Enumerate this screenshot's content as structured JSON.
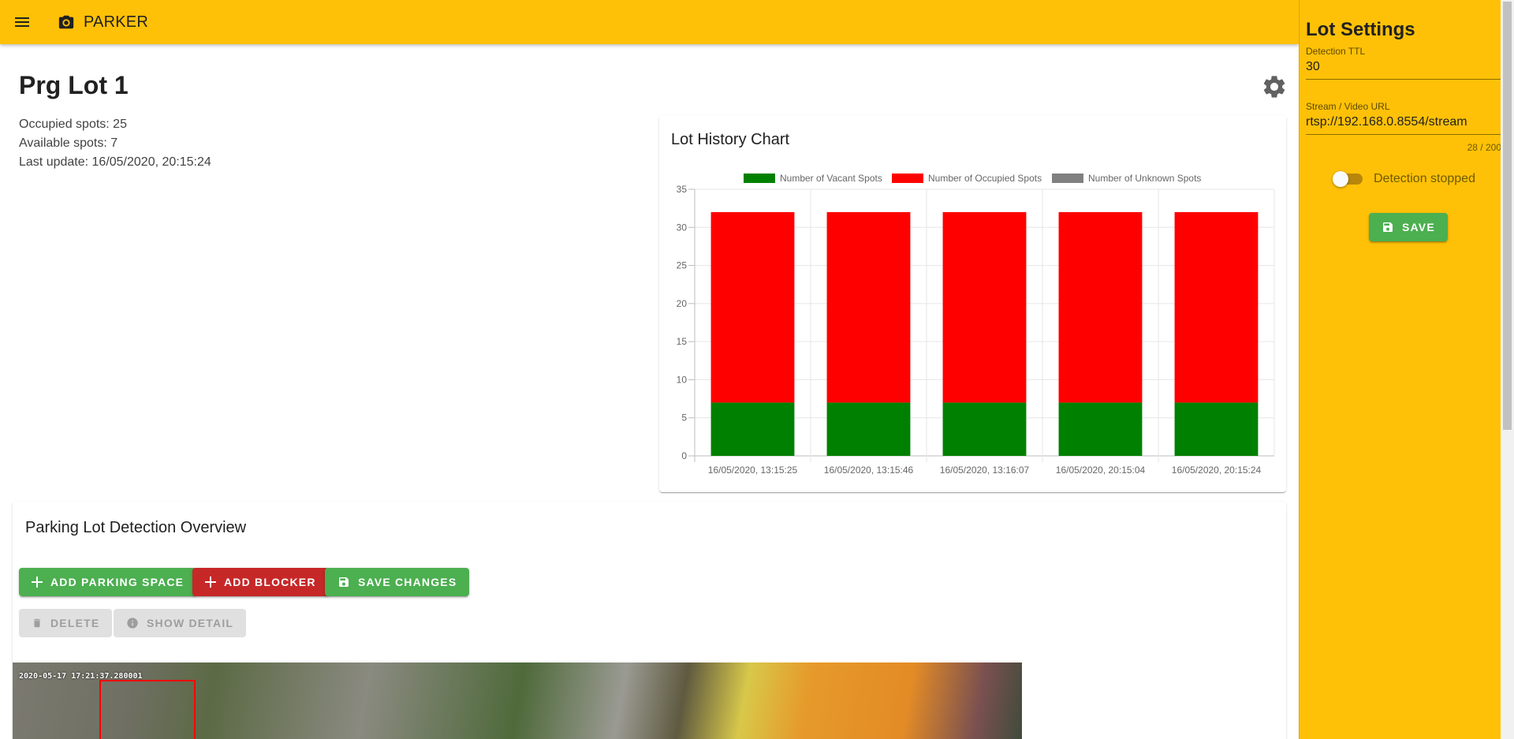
{
  "app": {
    "title": "PARKER"
  },
  "page": {
    "title": "Prg Lot 1",
    "stats": {
      "occupied": "Occupied spots: 25",
      "available": "Available spots: 7",
      "last_update": "Last update: 16/05/2020, 20:15:24"
    }
  },
  "chart_card": {
    "title": "Lot History Chart"
  },
  "chart_data": {
    "type": "bar",
    "stacked": true,
    "categories": [
      "16/05/2020, 13:15:25",
      "16/05/2020, 13:15:46",
      "16/05/2020, 13:16:07",
      "16/05/2020, 20:15:04",
      "16/05/2020, 20:15:24"
    ],
    "series": [
      {
        "name": "Number of Vacant Spots",
        "color": "#008000",
        "values": [
          7,
          7,
          7,
          7,
          7
        ]
      },
      {
        "name": "Number of Occupied Spots",
        "color": "#ff0000",
        "values": [
          25,
          25,
          25,
          25,
          25
        ]
      },
      {
        "name": "Number of Unknown Spots",
        "color": "#808080",
        "values": [
          0,
          0,
          0,
          0,
          0
        ]
      }
    ],
    "ylim": [
      0,
      35
    ],
    "yticks": [
      0,
      5,
      10,
      15,
      20,
      25,
      30,
      35
    ],
    "grid": true,
    "legend": "top"
  },
  "overview": {
    "title": "Parking Lot Detection Overview",
    "add_space_label": "ADD PARKING SPACE",
    "add_blocker_label": "ADD BLOCKER",
    "save_changes_label": "SAVE CHANGES",
    "delete_label": "DELETE",
    "show_detail_label": "SHOW DETAIL",
    "camera_timestamp": "2020-05-17 17:21:37.280001"
  },
  "settings": {
    "title": "Lot Settings",
    "ttl_label": "Detection TTL",
    "ttl_value": "30",
    "url_label": "Stream / Video URL",
    "url_value": "rtsp://192.168.0.8554/stream",
    "url_counter": "28 / 200",
    "toggle_label": "Detection stopped",
    "save_label": "SAVE"
  },
  "colors": {
    "accent": "#ffc107",
    "primary_button": "#4caf50",
    "danger_button": "#c62828"
  }
}
